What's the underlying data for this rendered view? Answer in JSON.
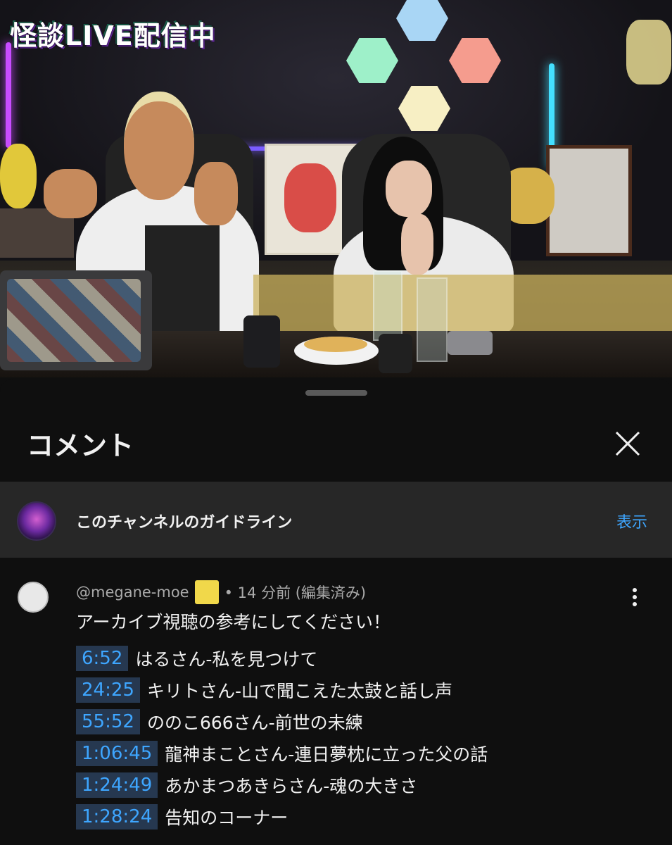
{
  "video": {
    "overlay_title": "怪談LIVE配信中"
  },
  "sheet": {
    "title": "コメント",
    "close_icon": "close-icon"
  },
  "guideline": {
    "text": "このチャンネルのガイドライン",
    "action": "表示"
  },
  "comment": {
    "author": "@megane-moe",
    "meta": "• 14 分前 (編集済み)",
    "intro": "アーカイブ視聴の参考にしてください！",
    "timestamps": [
      {
        "time": "6:52",
        "label": "はるさん-私を見つけて"
      },
      {
        "time": "24:25",
        "label": "キリトさん-山で聞こえた太鼓と話し声"
      },
      {
        "time": "55:52",
        "label": "ののこ666さん-前世の未練"
      },
      {
        "time": "1:06:45",
        "label": "龍神まことさん-連日夢枕に立った父の話"
      },
      {
        "time": "1:24:49",
        "label": "あかまつあきらさん-魂の大きさ"
      },
      {
        "time": "1:28:24",
        "label": "告知のコーナー"
      }
    ]
  },
  "colors": {
    "background": "#0f0f0f",
    "link": "#3ea6ff",
    "timestamp_bg": "#263850",
    "guideline_bg": "#272727"
  }
}
